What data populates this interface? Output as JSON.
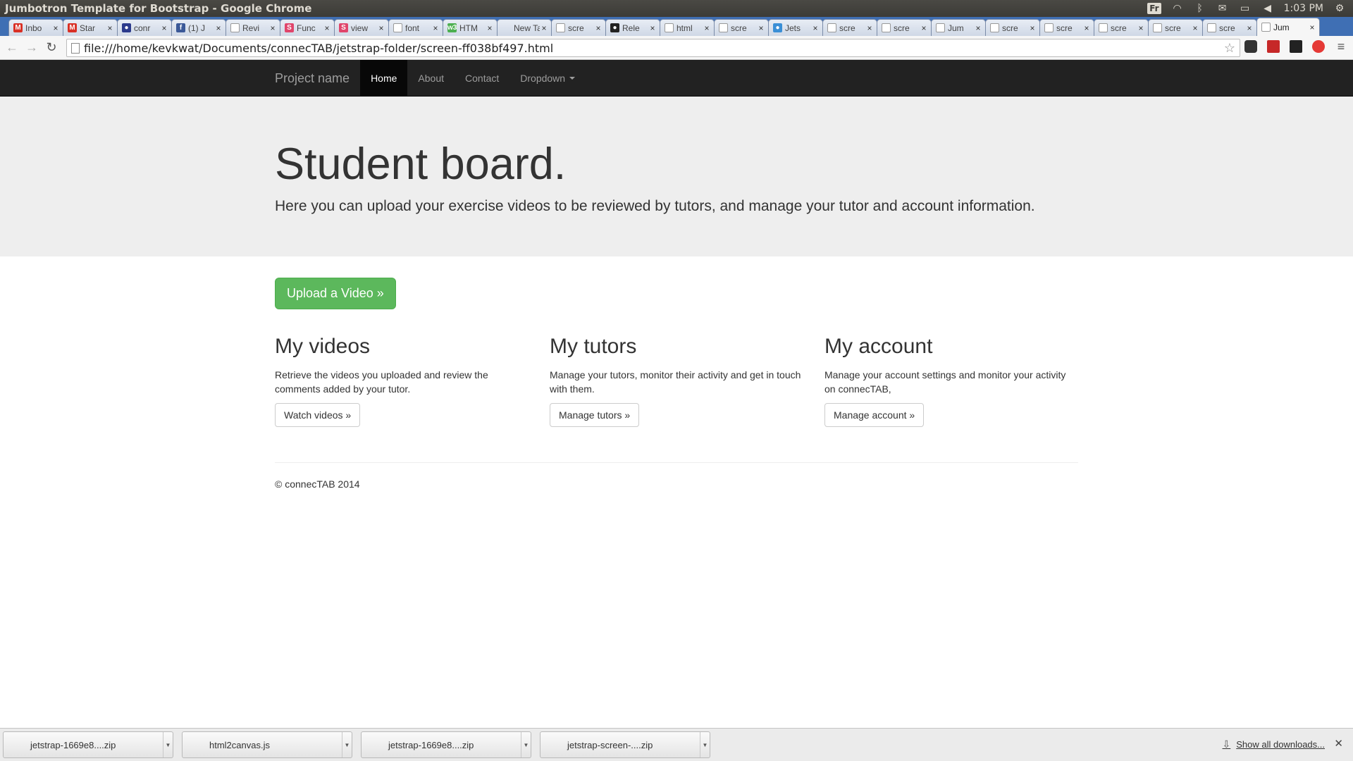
{
  "window": {
    "title": "Jumbotron Template for Bootstrap - Google Chrome"
  },
  "tray": {
    "lang": "Fr",
    "time": "1:03 PM"
  },
  "tabs": [
    {
      "title": "Inbo",
      "fav": "M",
      "color": "#d93025"
    },
    {
      "title": "Star",
      "fav": "M",
      "color": "#d93025"
    },
    {
      "title": "conr",
      "fav": "●",
      "color": "#2b3a8c"
    },
    {
      "title": "(1) J",
      "fav": "f",
      "color": "#3b5998"
    },
    {
      "title": "Revi",
      "fav": "",
      "color": "#ffffff"
    },
    {
      "title": "Func",
      "fav": "S",
      "color": "#e0456b"
    },
    {
      "title": "view",
      "fav": "S",
      "color": "#e0456b"
    },
    {
      "title": "font",
      "fav": "",
      "color": "#ffffff"
    },
    {
      "title": "HTM",
      "fav": "w3",
      "color": "#4caf50"
    },
    {
      "title": "New Ta",
      "fav": "",
      "color": "transparent"
    },
    {
      "title": "scre",
      "fav": "",
      "color": "#ffffff"
    },
    {
      "title": "Rele",
      "fav": "●",
      "color": "#222222"
    },
    {
      "title": "html",
      "fav": "",
      "color": "#ffffff"
    },
    {
      "title": "scre",
      "fav": "",
      "color": "#ffffff"
    },
    {
      "title": "Jets",
      "fav": "●",
      "color": "#3b8fd6"
    },
    {
      "title": "scre",
      "fav": "",
      "color": "#ffffff"
    },
    {
      "title": "scre",
      "fav": "",
      "color": "#ffffff"
    },
    {
      "title": "Jum",
      "fav": "",
      "color": "#ffffff"
    },
    {
      "title": "scre",
      "fav": "",
      "color": "#ffffff"
    },
    {
      "title": "scre",
      "fav": "",
      "color": "#ffffff"
    },
    {
      "title": "scre",
      "fav": "",
      "color": "#ffffff"
    },
    {
      "title": "scre",
      "fav": "",
      "color": "#ffffff"
    },
    {
      "title": "scre",
      "fav": "",
      "color": "#ffffff"
    },
    {
      "title": "Jum",
      "fav": "",
      "color": "#ffffff",
      "active": true
    }
  ],
  "toolbar": {
    "url": "file:///home/kevkwat/Documents/connecTAB/jetstrap-folder/screen-ff038bf497.html"
  },
  "navbar": {
    "brand": "Project name",
    "items": [
      "Home",
      "About",
      "Contact",
      "Dropdown"
    ]
  },
  "jumbotron": {
    "title": "Student board.",
    "lead": "Here you can upload your exercise videos to be reviewed by tutors, and manage your tutor and account information."
  },
  "upload_button": "Upload a Video »",
  "columns": [
    {
      "heading": "My videos",
      "text": "Retrieve the videos you uploaded and review the comments added by your tutor.",
      "button": "Watch videos »"
    },
    {
      "heading": "My tutors",
      "text": "Manage your tutors, monitor their activity and get in touch with them.",
      "button": "Manage tutors »"
    },
    {
      "heading": "My account",
      "text": "Manage your account settings and monitor your activity on connecTAB,",
      "button": "Manage account »"
    }
  ],
  "footer": "© connecTAB 2014",
  "downloads": {
    "items": [
      "jetstrap-1669e8....zip",
      "html2canvas.js",
      "jetstrap-1669e8....zip",
      "jetstrap-screen-....zip"
    ],
    "show_all": "Show all downloads..."
  },
  "colors": {
    "brand_green": "#5cb85c",
    "navbar": "#222222",
    "jumbotron": "#eeeeee",
    "tabstrip": "#3f6fb4"
  }
}
